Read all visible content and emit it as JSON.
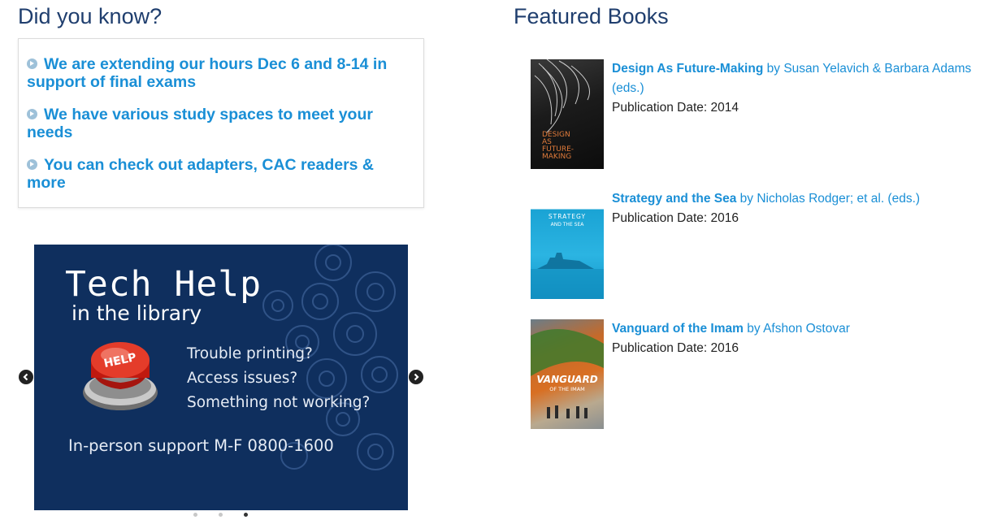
{
  "did_you_know": {
    "heading": "Did you know?",
    "items": [
      "We are extending our hours Dec 6 and 8-14 in support of final exams",
      "We have various study spaces to meet your needs",
      "You can check out adapters, CAC readers & more"
    ]
  },
  "slider": {
    "title": "Tech Help",
    "subtitle": "in the library",
    "button_text": "HELP",
    "questions": [
      "Trouble printing?",
      "Access issues?",
      "Something not working?"
    ],
    "support": "In-person support M-F 0800-1600",
    "prev_icon": "chevron-left-icon",
    "next_icon": "chevron-right-icon",
    "slide_count": 3,
    "active_slide": 3
  },
  "featured_books": {
    "heading": "Featured Books",
    "date_label": "Publication Date:",
    "books": [
      {
        "title": "Design As Future-Making",
        "by": "by",
        "author": "Susan Yelavich & Barbara Adams (eds.)",
        "date": "2014",
        "cover_text": [
          "DESIGN",
          "AS",
          "FUTURE-",
          "MAKING"
        ]
      },
      {
        "title": "Strategy and the Sea",
        "by": "by",
        "author": "Nicholas Rodger; et al. (eds.)",
        "date": "2016",
        "cover_text": [
          "STRATEGY",
          "AND THE SEA"
        ]
      },
      {
        "title": "Vanguard of the Imam",
        "by": "by",
        "author": "Afshon Ostovar",
        "date": "2016",
        "cover_text": [
          "VANGUARD",
          "OF THE IMAM"
        ]
      }
    ]
  },
  "colors": {
    "heading": "#1f3e6e",
    "link": "#1a8fd6",
    "slide_bg": "#0f2f5e"
  }
}
